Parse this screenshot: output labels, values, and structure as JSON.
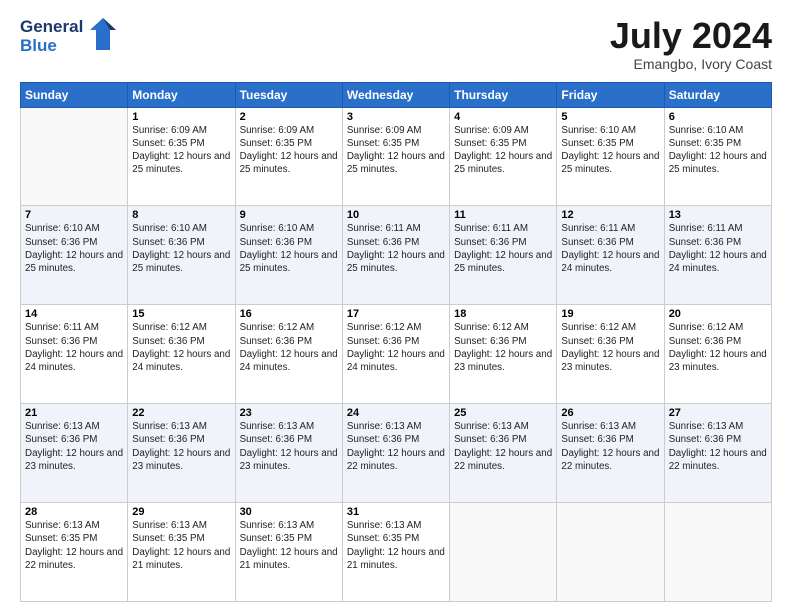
{
  "header": {
    "logo_line1": "General",
    "logo_line2": "Blue",
    "main_title": "July 2024",
    "subtitle": "Emangbo, Ivory Coast"
  },
  "columns": [
    "Sunday",
    "Monday",
    "Tuesday",
    "Wednesday",
    "Thursday",
    "Friday",
    "Saturday"
  ],
  "weeks": [
    [
      {
        "day": "",
        "sunrise": "",
        "sunset": "",
        "daylight": ""
      },
      {
        "day": "1",
        "sunrise": "Sunrise: 6:09 AM",
        "sunset": "Sunset: 6:35 PM",
        "daylight": "Daylight: 12 hours and 25 minutes."
      },
      {
        "day": "2",
        "sunrise": "Sunrise: 6:09 AM",
        "sunset": "Sunset: 6:35 PM",
        "daylight": "Daylight: 12 hours and 25 minutes."
      },
      {
        "day": "3",
        "sunrise": "Sunrise: 6:09 AM",
        "sunset": "Sunset: 6:35 PM",
        "daylight": "Daylight: 12 hours and 25 minutes."
      },
      {
        "day": "4",
        "sunrise": "Sunrise: 6:09 AM",
        "sunset": "Sunset: 6:35 PM",
        "daylight": "Daylight: 12 hours and 25 minutes."
      },
      {
        "day": "5",
        "sunrise": "Sunrise: 6:10 AM",
        "sunset": "Sunset: 6:35 PM",
        "daylight": "Daylight: 12 hours and 25 minutes."
      },
      {
        "day": "6",
        "sunrise": "Sunrise: 6:10 AM",
        "sunset": "Sunset: 6:35 PM",
        "daylight": "Daylight: 12 hours and 25 minutes."
      }
    ],
    [
      {
        "day": "7",
        "sunrise": "Sunrise: 6:10 AM",
        "sunset": "Sunset: 6:36 PM",
        "daylight": "Daylight: 12 hours and 25 minutes."
      },
      {
        "day": "8",
        "sunrise": "Sunrise: 6:10 AM",
        "sunset": "Sunset: 6:36 PM",
        "daylight": "Daylight: 12 hours and 25 minutes."
      },
      {
        "day": "9",
        "sunrise": "Sunrise: 6:10 AM",
        "sunset": "Sunset: 6:36 PM",
        "daylight": "Daylight: 12 hours and 25 minutes."
      },
      {
        "day": "10",
        "sunrise": "Sunrise: 6:11 AM",
        "sunset": "Sunset: 6:36 PM",
        "daylight": "Daylight: 12 hours and 25 minutes."
      },
      {
        "day": "11",
        "sunrise": "Sunrise: 6:11 AM",
        "sunset": "Sunset: 6:36 PM",
        "daylight": "Daylight: 12 hours and 25 minutes."
      },
      {
        "day": "12",
        "sunrise": "Sunrise: 6:11 AM",
        "sunset": "Sunset: 6:36 PM",
        "daylight": "Daylight: 12 hours and 24 minutes."
      },
      {
        "day": "13",
        "sunrise": "Sunrise: 6:11 AM",
        "sunset": "Sunset: 6:36 PM",
        "daylight": "Daylight: 12 hours and 24 minutes."
      }
    ],
    [
      {
        "day": "14",
        "sunrise": "Sunrise: 6:11 AM",
        "sunset": "Sunset: 6:36 PM",
        "daylight": "Daylight: 12 hours and 24 minutes."
      },
      {
        "day": "15",
        "sunrise": "Sunrise: 6:12 AM",
        "sunset": "Sunset: 6:36 PM",
        "daylight": "Daylight: 12 hours and 24 minutes."
      },
      {
        "day": "16",
        "sunrise": "Sunrise: 6:12 AM",
        "sunset": "Sunset: 6:36 PM",
        "daylight": "Daylight: 12 hours and 24 minutes."
      },
      {
        "day": "17",
        "sunrise": "Sunrise: 6:12 AM",
        "sunset": "Sunset: 6:36 PM",
        "daylight": "Daylight: 12 hours and 24 minutes."
      },
      {
        "day": "18",
        "sunrise": "Sunrise: 6:12 AM",
        "sunset": "Sunset: 6:36 PM",
        "daylight": "Daylight: 12 hours and 23 minutes."
      },
      {
        "day": "19",
        "sunrise": "Sunrise: 6:12 AM",
        "sunset": "Sunset: 6:36 PM",
        "daylight": "Daylight: 12 hours and 23 minutes."
      },
      {
        "day": "20",
        "sunrise": "Sunrise: 6:12 AM",
        "sunset": "Sunset: 6:36 PM",
        "daylight": "Daylight: 12 hours and 23 minutes."
      }
    ],
    [
      {
        "day": "21",
        "sunrise": "Sunrise: 6:13 AM",
        "sunset": "Sunset: 6:36 PM",
        "daylight": "Daylight: 12 hours and 23 minutes."
      },
      {
        "day": "22",
        "sunrise": "Sunrise: 6:13 AM",
        "sunset": "Sunset: 6:36 PM",
        "daylight": "Daylight: 12 hours and 23 minutes."
      },
      {
        "day": "23",
        "sunrise": "Sunrise: 6:13 AM",
        "sunset": "Sunset: 6:36 PM",
        "daylight": "Daylight: 12 hours and 23 minutes."
      },
      {
        "day": "24",
        "sunrise": "Sunrise: 6:13 AM",
        "sunset": "Sunset: 6:36 PM",
        "daylight": "Daylight: 12 hours and 22 minutes."
      },
      {
        "day": "25",
        "sunrise": "Sunrise: 6:13 AM",
        "sunset": "Sunset: 6:36 PM",
        "daylight": "Daylight: 12 hours and 22 minutes."
      },
      {
        "day": "26",
        "sunrise": "Sunrise: 6:13 AM",
        "sunset": "Sunset: 6:36 PM",
        "daylight": "Daylight: 12 hours and 22 minutes."
      },
      {
        "day": "27",
        "sunrise": "Sunrise: 6:13 AM",
        "sunset": "Sunset: 6:36 PM",
        "daylight": "Daylight: 12 hours and 22 minutes."
      }
    ],
    [
      {
        "day": "28",
        "sunrise": "Sunrise: 6:13 AM",
        "sunset": "Sunset: 6:35 PM",
        "daylight": "Daylight: 12 hours and 22 minutes."
      },
      {
        "day": "29",
        "sunrise": "Sunrise: 6:13 AM",
        "sunset": "Sunset: 6:35 PM",
        "daylight": "Daylight: 12 hours and 21 minutes."
      },
      {
        "day": "30",
        "sunrise": "Sunrise: 6:13 AM",
        "sunset": "Sunset: 6:35 PM",
        "daylight": "Daylight: 12 hours and 21 minutes."
      },
      {
        "day": "31",
        "sunrise": "Sunrise: 6:13 AM",
        "sunset": "Sunset: 6:35 PM",
        "daylight": "Daylight: 12 hours and 21 minutes."
      },
      {
        "day": "",
        "sunrise": "",
        "sunset": "",
        "daylight": ""
      },
      {
        "day": "",
        "sunrise": "",
        "sunset": "",
        "daylight": ""
      },
      {
        "day": "",
        "sunrise": "",
        "sunset": "",
        "daylight": ""
      }
    ]
  ]
}
